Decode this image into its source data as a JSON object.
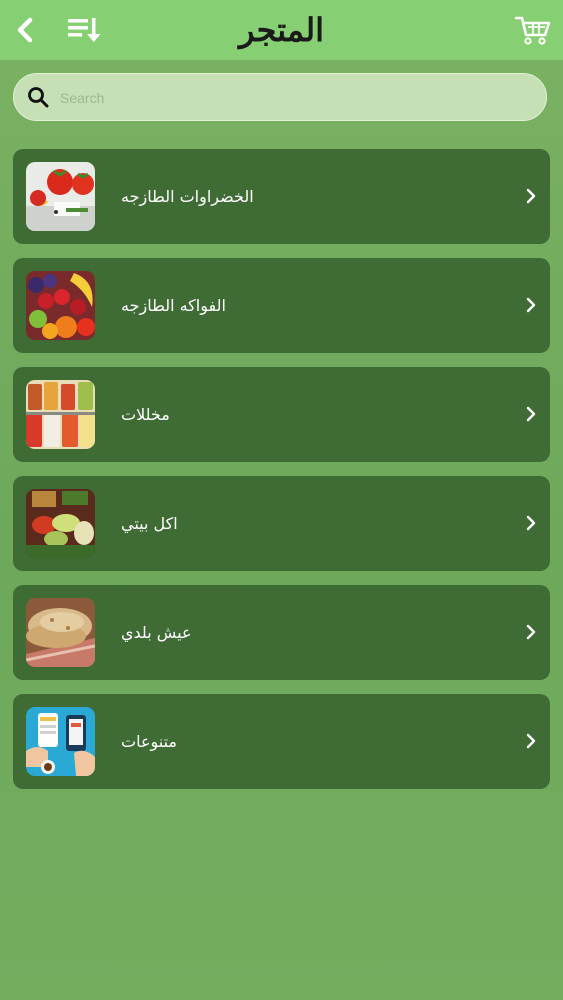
{
  "header": {
    "title": "المتجر",
    "back_icon": "back-chevron-icon",
    "sort_icon": "sort-list-icon",
    "cart_icon": "shopping-cart-icon"
  },
  "search": {
    "placeholder": "Search",
    "value": ""
  },
  "categories": [
    {
      "label": "الخضراوات الطازجه",
      "image": "fresh-vegetables-image"
    },
    {
      "label": "الفواكه الطازجه",
      "image": "fresh-fruits-image"
    },
    {
      "label": "مخللات",
      "image": "pickles-jars-image"
    },
    {
      "label": "اكل بيتي",
      "image": "homemade-food-image"
    },
    {
      "label": "عيش بلدي",
      "image": "baladi-bread-image"
    },
    {
      "label": "متنوعات",
      "image": "miscellaneous-phone-image"
    }
  ],
  "colors": {
    "header_bg": "#86cf72",
    "card_bg": "#3f6b35",
    "page_bg": "#72aa5c",
    "search_bg": "#c6dfb5"
  }
}
